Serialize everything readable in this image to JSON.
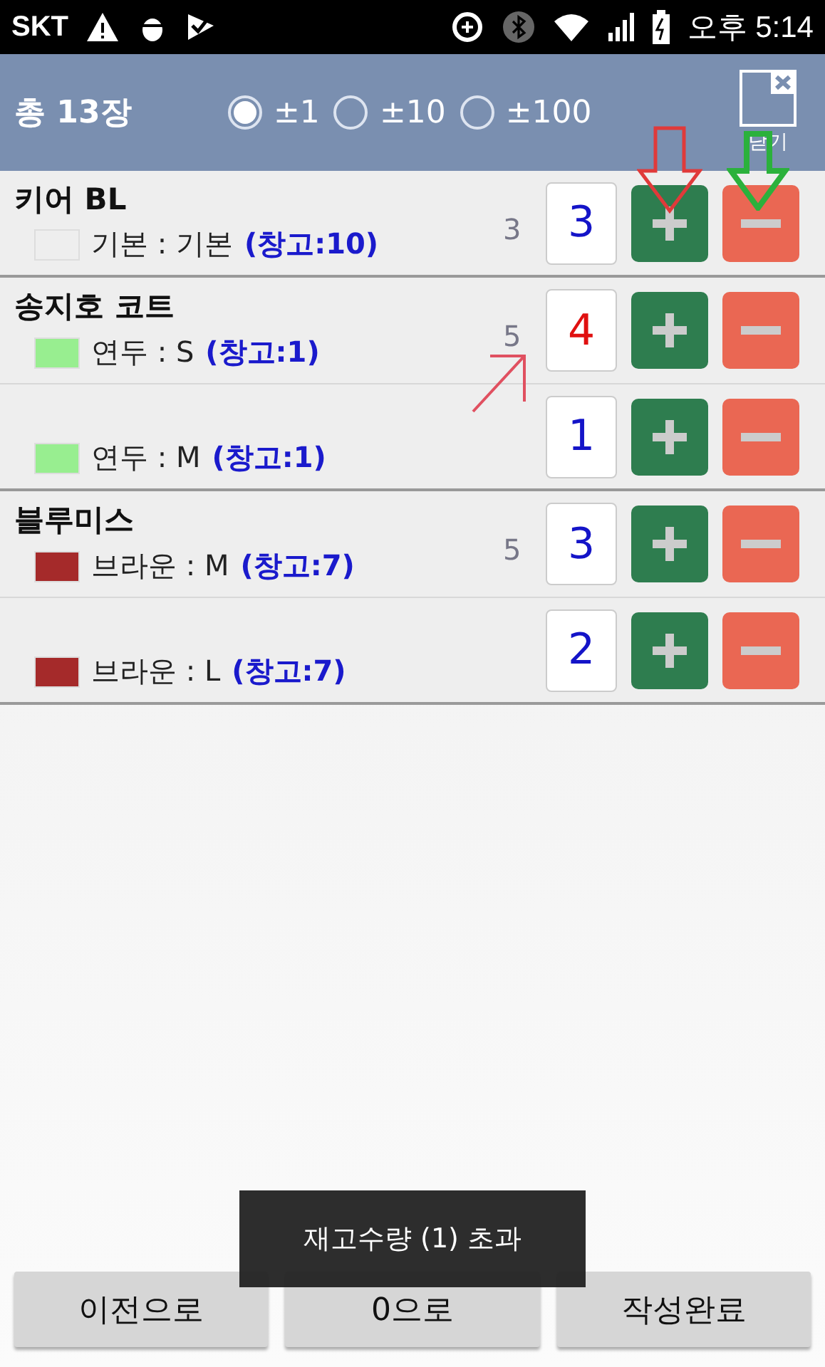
{
  "status_bar": {
    "carrier": "SKT",
    "time": "오후 5:14"
  },
  "header": {
    "total": "총 13장",
    "steps": [
      {
        "label": "±1",
        "selected": true
      },
      {
        "label": "±10",
        "selected": false
      },
      {
        "label": "±100",
        "selected": false
      }
    ],
    "close_label": "닫기"
  },
  "groups": [
    {
      "name": "키어 BL",
      "count": "3",
      "items": [
        {
          "color": "#eeeeee",
          "option": "기본 : 기본",
          "stock": "(창고:10)",
          "qty": "3",
          "over": false
        }
      ]
    },
    {
      "name": "송지호 코트",
      "count": "5",
      "items": [
        {
          "color": "#98ee90",
          "option": "연두 : S",
          "stock": "(창고:1)",
          "qty": "4",
          "over": true
        },
        {
          "color": "#98ee90",
          "option": "연두 : M",
          "stock": "(창고:1)",
          "qty": "1",
          "over": false
        }
      ]
    },
    {
      "name": "블루미스",
      "count": "5",
      "items": [
        {
          "color": "#a52a2a",
          "option": "브라운 : M",
          "stock": "(창고:7)",
          "qty": "3",
          "over": false
        },
        {
          "color": "#a52a2a",
          "option": "브라운 : L",
          "stock": "(창고:7)",
          "qty": "2",
          "over": false
        }
      ]
    }
  ],
  "buttons": [
    "이전으로",
    "0으로",
    "작성완료"
  ],
  "toast": "재고수량 (1) 초과"
}
